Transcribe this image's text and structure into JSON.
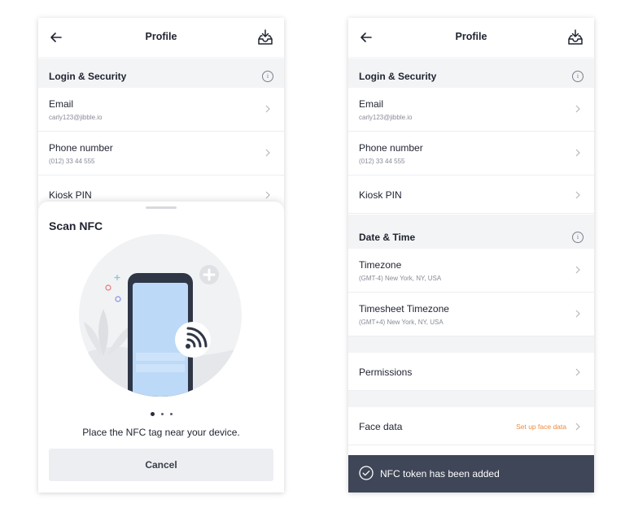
{
  "left_screen": {
    "header": {
      "title": "Profile",
      "back_icon": "arrow-left-icon",
      "action_icon": "inbox-download-icon"
    },
    "login_security": {
      "title": "Login & Security",
      "info_glyph": "i",
      "rows": [
        {
          "label": "Email",
          "value": "carly123@jibble.io"
        },
        {
          "label": "Phone number",
          "value": "(012) 33 44 555"
        },
        {
          "label": "Kiosk PIN"
        }
      ]
    },
    "sheet": {
      "title": "Scan NFC",
      "illustration_icon": "nfc-phone-illustration",
      "pager_total": 3,
      "pager_active": 1,
      "message": "Place the NFC tag near your device.",
      "cancel_label": "Cancel"
    }
  },
  "right_screen": {
    "header": {
      "title": "Profile",
      "back_icon": "arrow-left-icon",
      "action_icon": "inbox-download-icon"
    },
    "login_security": {
      "title": "Login & Security",
      "info_glyph": "i",
      "rows": [
        {
          "label": "Email",
          "value": "carly123@jibble.io"
        },
        {
          "label": "Phone number",
          "value": "(012) 33 44 555"
        },
        {
          "label": "Kiosk PIN"
        }
      ]
    },
    "date_time": {
      "title": "Date & Time",
      "info_glyph": "i",
      "rows": [
        {
          "label": "Timezone",
          "value": "(GMT-4) New York, NY, USA"
        },
        {
          "label": "Timesheet Timezone",
          "value": "(GMT+4) New York, NY, USA"
        }
      ]
    },
    "permissions": {
      "label": "Permissions"
    },
    "face_data": {
      "label": "Face data",
      "hint": "Set up face data"
    },
    "toast": {
      "icon": "check-circle-icon",
      "message": "NFC token has been added"
    }
  },
  "colors": {
    "section_bg": "#f3f4f6",
    "accent_orange": "#f08a3c",
    "toast_bg": "#3f4657",
    "illustration_blue": "#bcd9f7"
  }
}
